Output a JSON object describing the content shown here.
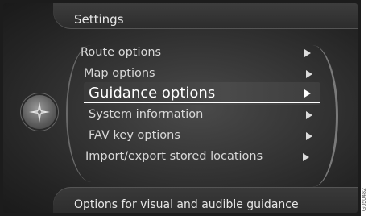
{
  "header": {
    "title": "Settings"
  },
  "menu": {
    "items": [
      {
        "label": "Route options"
      },
      {
        "label": "Map options"
      },
      {
        "label": "Guidance options",
        "selected": true
      },
      {
        "label": "System information"
      },
      {
        "label": "FAV key options"
      },
      {
        "label": "Import/export stored locations"
      }
    ]
  },
  "footer": {
    "description": "Options for visual and audible guidance"
  },
  "image_code": "G050482",
  "icons": {
    "compass": "compass-icon",
    "arrow": "arrow-right-icon"
  }
}
